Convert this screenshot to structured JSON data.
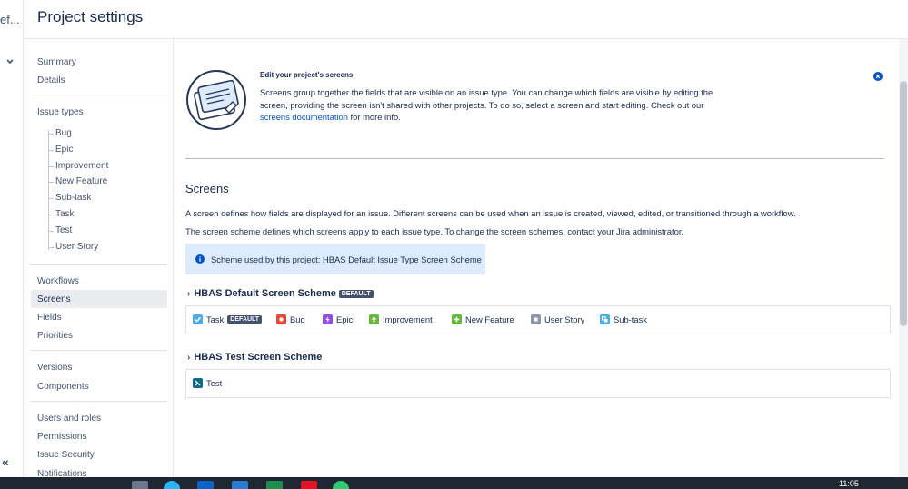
{
  "rail": {
    "truncated_label": "ef..."
  },
  "header": {
    "title": "Project settings"
  },
  "sidebar": {
    "items_top": [
      "Summary",
      "Details"
    ],
    "issue_types_label": "Issue types",
    "issue_types": [
      "Bug",
      "Epic",
      "Improvement",
      "New Feature",
      "Sub-task",
      "Task",
      "Test",
      "User Story"
    ],
    "group2": [
      "Workflows",
      "Screens",
      "Fields",
      "Priorities"
    ],
    "group3": [
      "Versions",
      "Components"
    ],
    "group4": [
      "Users and roles",
      "Permissions",
      "Issue Security",
      "Notifications"
    ],
    "active": "Screens"
  },
  "info": {
    "title": "Edit your project's screens",
    "text_before_link": "Screens group together the fields that are visible on an issue type. You can change which fields are visible by editing the screen, providing the screen isn't shared with other projects. To do so, select a screen and start editing. Check out our ",
    "link": "screens documentation",
    "text_after_link": " for more info."
  },
  "main": {
    "title": "Screens",
    "para1": "A screen defines how fields are displayed for an issue. Different screens can be used when an issue is created, viewed, edited, or transitioned through a workflow.",
    "para2": "The screen scheme defines which screens apply to each issue type. To change the screen schemes, contact your Jira administrator.",
    "scheme_notice": "Scheme used by this project: HBAS Default Issue Type Screen Scheme"
  },
  "schemes": [
    {
      "name": "HBAS Default Screen Scheme",
      "badge": "DEFAULT",
      "issue_types": [
        {
          "label": "Task",
          "badge": "DEFAULT",
          "icon": "task-icon",
          "color": "#4bade8"
        },
        {
          "label": "Bug",
          "icon": "bug-icon",
          "color": "#e5493a"
        },
        {
          "label": "Epic",
          "icon": "epic-icon",
          "color": "#904ee2"
        },
        {
          "label": "Improvement",
          "icon": "improvement-icon",
          "color": "#63ba3c"
        },
        {
          "label": "New Feature",
          "icon": "new-feature-icon",
          "color": "#63ba3c"
        },
        {
          "label": "User Story",
          "icon": "user-story-icon",
          "color": "#8b96a6"
        },
        {
          "label": "Sub-task",
          "icon": "subtask-icon",
          "color": "#4bade8"
        }
      ]
    },
    {
      "name": "HBAS Test Screen Scheme",
      "issue_types": [
        {
          "label": "Test",
          "icon": "test-icon",
          "color": "#0e6a8a"
        }
      ]
    }
  ],
  "taskbar": {
    "time": "11:05"
  },
  "colors": {
    "link": "#0052cc",
    "notice_bg": "#deebff",
    "lozenge": "#42526e"
  }
}
